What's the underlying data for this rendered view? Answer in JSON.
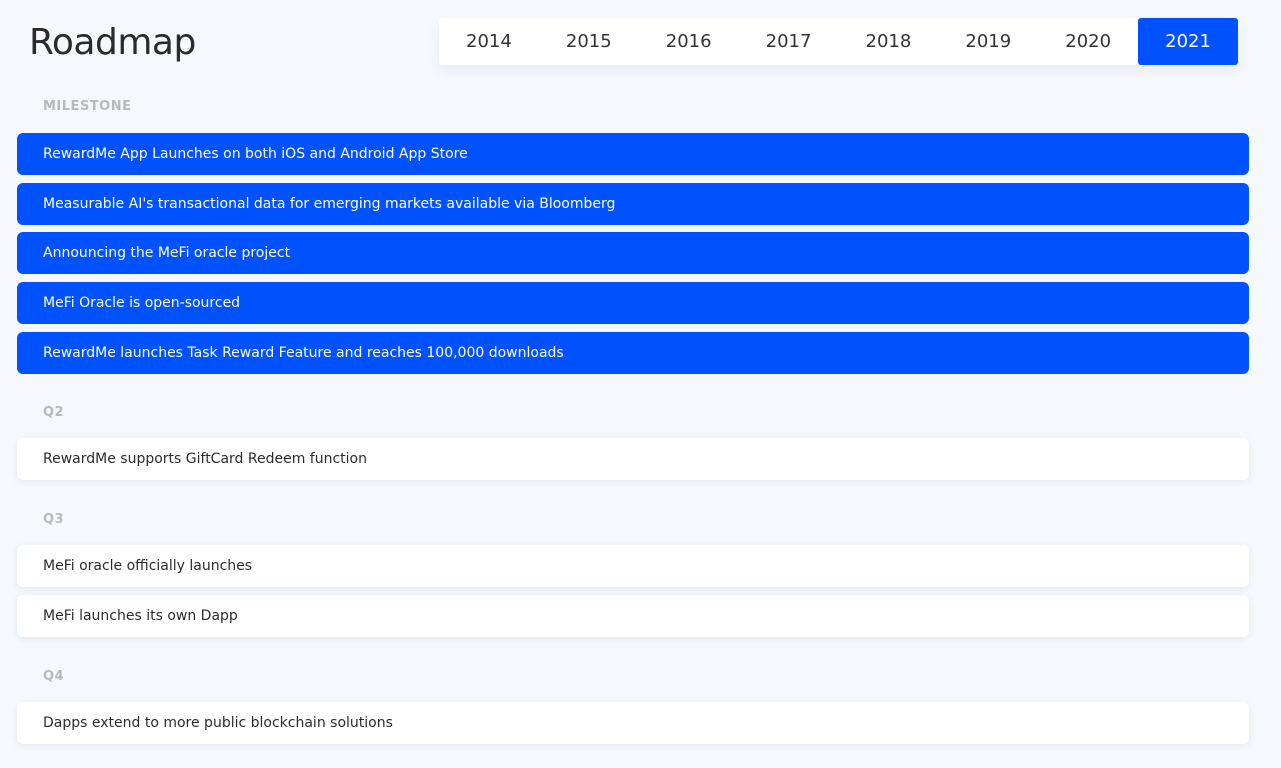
{
  "header": {
    "title": "Roadmap"
  },
  "years": [
    "2014",
    "2015",
    "2016",
    "2017",
    "2018",
    "2019",
    "2020",
    "2021"
  ],
  "selected_year": "2021",
  "colors": {
    "accent": "#0051ff",
    "background": "#f5f9fd",
    "card": "#ffffff",
    "section_label": "#b5b9bf"
  },
  "sections": [
    {
      "label": "MILESTONE",
      "highlighted": true,
      "items": [
        "RewardMe App Launches on both iOS and Android App Store",
        "Measurable AI's transactional data for emerging markets available via Bloomberg",
        "Announcing the MeFi oracle project",
        "MeFi Oracle is open-sourced",
        "RewardMe launches Task Reward Feature and reaches 100,000 downloads"
      ]
    },
    {
      "label": "Q2",
      "highlighted": false,
      "items": [
        "RewardMe supports GiftCard Redeem function"
      ]
    },
    {
      "label": "Q3",
      "highlighted": false,
      "items": [
        "MeFi oracle officially launches",
        "MeFi launches its own Dapp"
      ]
    },
    {
      "label": "Q4",
      "highlighted": false,
      "items": [
        "Dapps extend to more public blockchain solutions"
      ]
    }
  ]
}
